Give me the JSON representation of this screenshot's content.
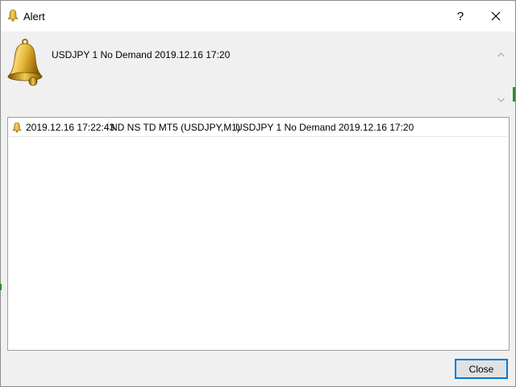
{
  "window": {
    "title": "Alert",
    "help_label": "?",
    "close_icon": "close-icon"
  },
  "message": {
    "text": "USDJPY 1 No Demand  2019.12.16 17:20"
  },
  "list": {
    "rows": [
      {
        "time": "2019.12.16 17:22:43",
        "source": "ND NS TD MT5 (USDJPY,M1)",
        "message": "USDJPY 1 No Demand  2019.12.16 17:20"
      }
    ]
  },
  "buttons": {
    "close_label": "Close"
  },
  "colors": {
    "accent": "#0078d7",
    "bell_gold": "#d9a520"
  }
}
